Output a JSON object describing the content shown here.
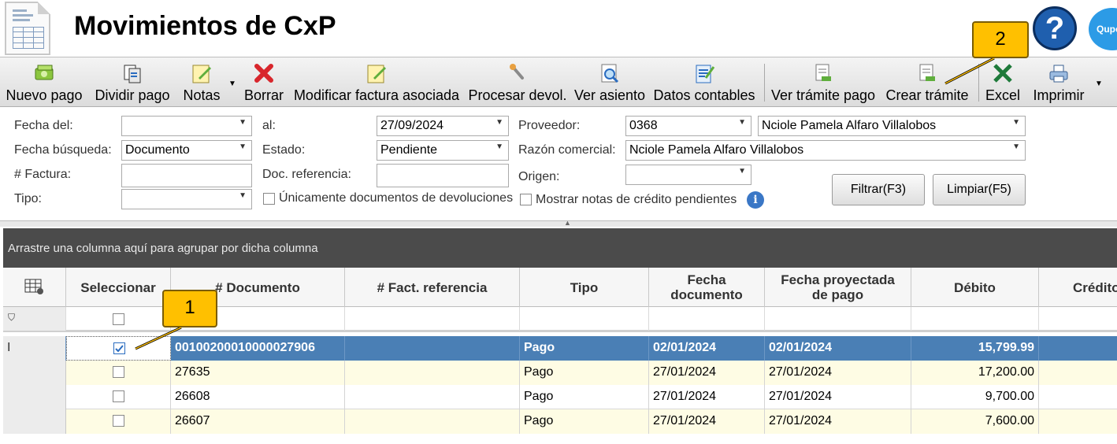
{
  "window": {
    "title": "Movimientos de CxP"
  },
  "toolbar": {
    "nuevo_pago": "Nuevo pago",
    "dividir_pago": "Dividir pago",
    "notas": "Notas",
    "borrar": "Borrar",
    "modificar": "Modificar factura asociada",
    "procesar": "Procesar devol.",
    "ver_asiento": "Ver asiento",
    "datos_contables": "Datos contables",
    "ver_tramite": "Ver trámite pago",
    "crear_tramite": "Crear trámite",
    "excel": "Excel",
    "imprimir": "Imprimir"
  },
  "filters": {
    "fecha_del_label": "Fecha del:",
    "fecha_del_value": "",
    "al_label": "al:",
    "al_value": "27/09/2024",
    "proveedor_label": "Proveedor:",
    "proveedor_code": "0368",
    "proveedor_name": "Nciole Pamela Alfaro Villalobos",
    "fecha_busqueda_label": "Fecha búsqueda:",
    "fecha_busqueda_value": "Documento",
    "estado_label": "Estado:",
    "estado_value": "Pendiente",
    "razon_label": "Razón comercial:",
    "razon_value": "Nciole Pamela Alfaro Villalobos",
    "factura_label": "# Factura:",
    "factura_value": "",
    "doc_ref_label": "Doc. referencia:",
    "doc_ref_value": "",
    "origen_label": "Origen:",
    "origen_value": "",
    "tipo_label": "Tipo:",
    "tipo_value": "",
    "solo_devol_label": "Únicamente documentos de devoluciones",
    "notas_credito_label": "Mostrar notas de crédito pendientes",
    "filtrar_button": "Filtrar(F3)",
    "limpiar_button": "Limpiar(F5)"
  },
  "grid": {
    "group_hint": "Arrastre una columna aquí para agrupar por dicha columna",
    "columns": {
      "seleccionar": "Seleccionar",
      "documento": "# Documento",
      "fact_ref": "# Fact. referencia",
      "tipo": "Tipo",
      "fecha_doc": "Fecha documento",
      "fecha_proy": "Fecha proyectada de pago",
      "debito": "Débito",
      "credito": "Crédito"
    },
    "rows": [
      {
        "documento": "00100200010000027906",
        "fact_ref": "",
        "tipo": "Pago",
        "fecha_doc": "02/01/2024",
        "fecha_proy": "02/01/2024",
        "debito": "15,799.99",
        "checked": true
      },
      {
        "documento": "27635",
        "fact_ref": "",
        "tipo": "Pago",
        "fecha_doc": "27/01/2024",
        "fecha_proy": "27/01/2024",
        "debito": "17,200.00",
        "checked": false
      },
      {
        "documento": "26608",
        "fact_ref": "",
        "tipo": "Pago",
        "fecha_doc": "27/01/2024",
        "fecha_proy": "27/01/2024",
        "debito": "9,700.00",
        "checked": false
      },
      {
        "documento": "26607",
        "fact_ref": "",
        "tipo": "Pago",
        "fecha_doc": "27/01/2024",
        "fecha_proy": "27/01/2024",
        "debito": "7,600.00",
        "checked": false
      }
    ]
  },
  "callouts": {
    "one": "1",
    "two": "2"
  },
  "colors": {
    "selected_row": "#4a7fb5",
    "alt_row": "#fefce4",
    "callout": "#ffc000"
  }
}
